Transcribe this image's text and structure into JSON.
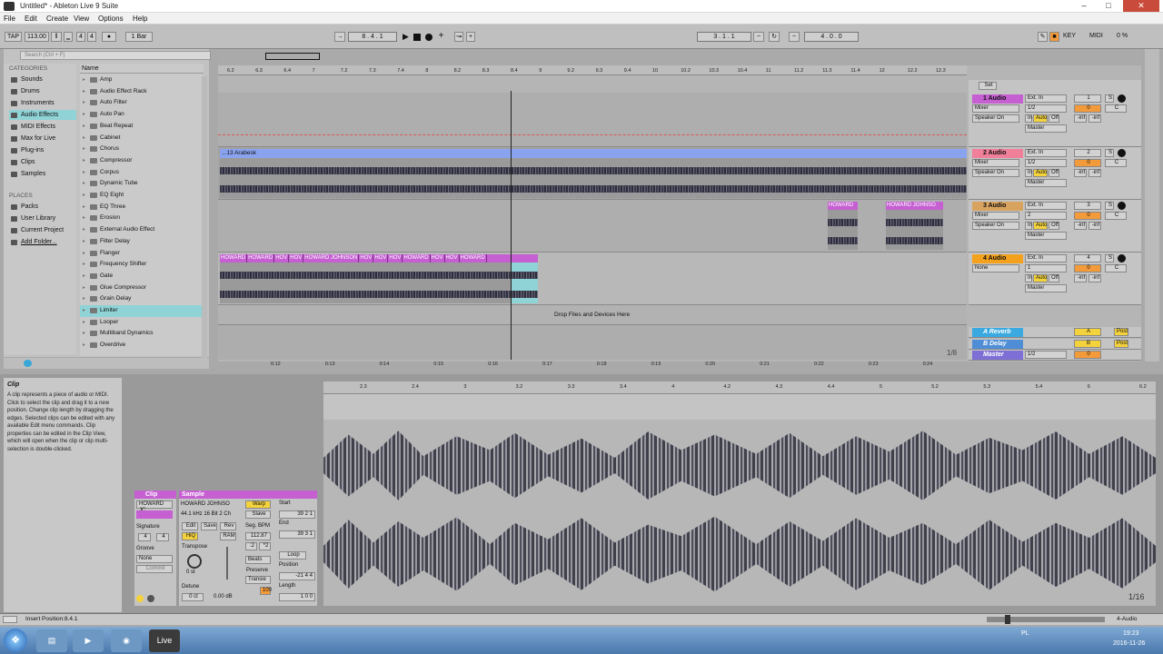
{
  "window": {
    "title": "Untitled* - Ableton Live 9 Suite"
  },
  "menu": [
    "File",
    "Edit",
    "Create",
    "View",
    "Options",
    "Help"
  ],
  "control_bar": {
    "tap": "TAP",
    "tempo": "113.00",
    "meter_num": "4",
    "meter_den": "4",
    "quantize": "1 Bar",
    "position": "8 . 4 . 1",
    "loop_start": "3 . 1 . 1",
    "loop_length": "4 . 0 . 0",
    "key": "KEY",
    "midi": "MIDI",
    "cpu": "0 %"
  },
  "browser": {
    "search_placeholder": "Search (Ctrl + F)",
    "categories_label": "CATEGORIES",
    "categories": [
      "Sounds",
      "Drums",
      "Instruments",
      "Audio Effects",
      "MIDI Effects",
      "Max for Live",
      "Plug-ins",
      "Clips",
      "Samples"
    ],
    "places_label": "PLACES",
    "places": [
      "Packs",
      "User Library",
      "Current Project",
      "Add Folder..."
    ],
    "name_header": "Name",
    "items": [
      "Amp",
      "Audio Effect Rack",
      "Auto Filter",
      "Auto Pan",
      "Beat Repeat",
      "Cabinet",
      "Chorus",
      "Compressor",
      "Corpus",
      "Dynamic Tube",
      "EQ Eight",
      "EQ Three",
      "Erosion",
      "External Audio Effect",
      "Filter Delay",
      "Flanger",
      "Frequency Shifter",
      "Gate",
      "Glue Compressor",
      "Grain Delay",
      "Limiter",
      "Looper",
      "Multiband Dynamics",
      "Overdrive"
    ]
  },
  "arrangement": {
    "ruler": [
      "6.2",
      "6.3",
      "6.4",
      "7",
      "7.2",
      "7.3",
      "7.4",
      "8",
      "8.2",
      "8.3",
      "8.4",
      "9",
      "9.2",
      "9.3",
      "9.4",
      "10",
      "10.2",
      "10.3",
      "10.4",
      "11",
      "11.2",
      "11.3",
      "11.4",
      "12",
      "12.2",
      "12.3"
    ],
    "time_ruler": [
      "0:12",
      "0:13",
      "0:14",
      "0:15",
      "0:16",
      "0:17",
      "0:18",
      "0:19",
      "0:20",
      "0:21",
      "0:22",
      "0:23",
      "0:24"
    ],
    "clip2_name": "...13 Arabesk",
    "clip3_names": [
      "HOWARD",
      "HOWARD JOHNSO"
    ],
    "clip4_names": [
      "HOWARD",
      "HOWARD",
      "HOV",
      "HOV",
      "HOWARD JOHNSON",
      "HOV",
      "HOV",
      "HOV",
      "HOWARD",
      "HOV",
      "HOV",
      "HOWARD"
    ],
    "drop_text": "Drop Files and Devices Here",
    "zoom": "1/8",
    "set_label": "Set",
    "tracks": [
      {
        "name": "1 Audio",
        "color": "#c55fd2",
        "num": "1",
        "input": "Ext. In",
        "ch": "1/2",
        "mon": "Mixer",
        "out": "Speaker On",
        "route": "Master"
      },
      {
        "name": "2 Audio",
        "color": "#f07f9a",
        "num": "2",
        "input": "Ext. In",
        "ch": "1/2",
        "mon": "Mixer",
        "out": "Speaker On",
        "route": "Master"
      },
      {
        "name": "3 Audio",
        "color": "#d8a35f",
        "num": "3",
        "input": "Ext. In",
        "ch": "2",
        "mon": "Mixer",
        "out": "Speaker On",
        "route": "Master"
      },
      {
        "name": "4 Audio",
        "color": "#f4a21e",
        "num": "4",
        "input": "Ext. In",
        "ch": "1",
        "mon": "None",
        "out": "",
        "route": "Master"
      }
    ],
    "returns": [
      {
        "name": "A Reverb",
        "letter": "A",
        "color": "#3aa9e0"
      },
      {
        "name": "B Delay",
        "letter": "B",
        "color": "#4f8ed7"
      },
      {
        "name": "Master",
        "letter": "",
        "color": "#7d6fd6"
      }
    ],
    "master_ch": "1/2",
    "post": "Post",
    "auto": "Auto",
    "off": "Off",
    "in": "In",
    "inf": "-inf",
    "vol": "0",
    "pan": "C",
    "solo": "S"
  },
  "info": {
    "title": "Clip",
    "text": "A clip represents a piece of audio or MIDI. Click to select the clip and drag it to a new position.  Change clip length by dragging the edges. Selected clips can be edited with any available Edit menu commands.  Clip properties can be edited in the Clip View, which will open when the clip or clip multi-selection is double-clicked."
  },
  "clip_view": {
    "clip_label": "Clip",
    "clip_name": "HOWARD JC",
    "signature_label": "Signature",
    "sig_num": "4",
    "sig_den": "4",
    "groove_label": "Groove",
    "groove_value": "None",
    "commit": "Commit",
    "sample_label": "Sample",
    "sample_name": "HOWARD JOHNSO",
    "sample_info": "44.1 kHz 16 Bit 2 Ch",
    "edit": "Edit",
    "save": "Save",
    "rev": "Rev",
    "hiq": "HiQ",
    "ram": "RAM",
    "transpose_label": "Transpose",
    "transpose": "0 st",
    "detune_label": "Detune",
    "detune": "0 ct",
    "gain": "0.00 dB",
    "warp": "Warp",
    "slave": "Slave",
    "seg_bpm_label": "Seg. BPM",
    "seg_bpm": "112.87",
    "half": ":2",
    "double": "*2",
    "warp_mode": "Beats",
    "preserve_label": "Preserve",
    "preserve": "Transie",
    "ratio": "100",
    "start_label": "Start",
    "start": "39  2  1",
    "end_label": "End",
    "end": "39  3  1",
    "loop": "Loop",
    "position_label": "Position",
    "position": "-21  4  4",
    "length_label": "Length",
    "length": "1  0  0"
  },
  "sample_ruler": [
    "2.3",
    "2.4",
    "3",
    "3.2",
    "3.3",
    "3.4",
    "4",
    "4.2",
    "4.3",
    "4.4",
    "5",
    "5.2",
    "5.3",
    "5.4",
    "6",
    "6.2"
  ],
  "sample_zoom": "1/16",
  "status": {
    "text": "Insert Position:8.4.1",
    "track": "4-Audio"
  },
  "taskbar": {
    "lang": "PL",
    "time": "19:23",
    "date": "2016-11-26",
    "app": "Live"
  }
}
